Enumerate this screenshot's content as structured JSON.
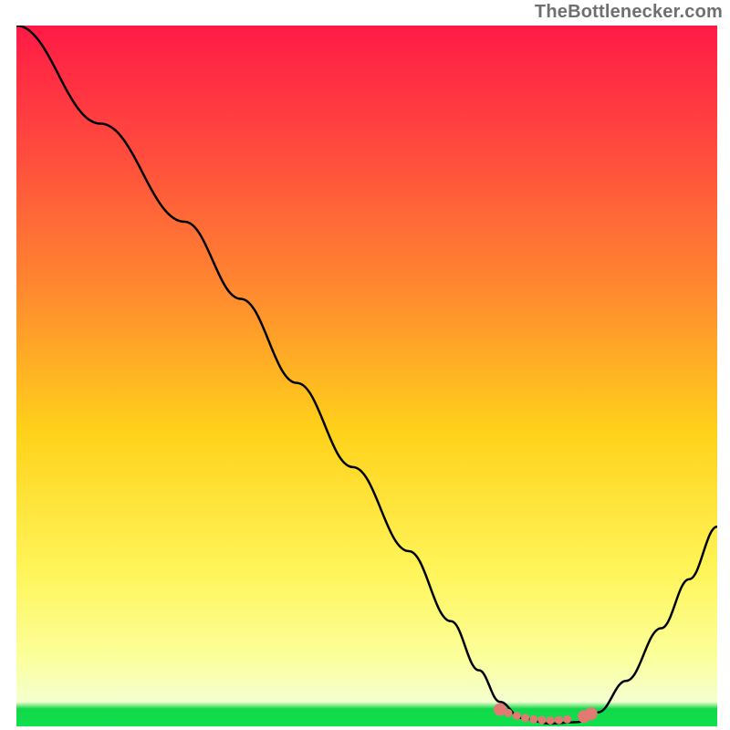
{
  "watermark": "TheBottlenecker.com",
  "chart_data": {
    "type": "line",
    "title": "",
    "xlabel": "",
    "ylabel": "",
    "xlim": [
      0,
      100
    ],
    "ylim": [
      0,
      100
    ],
    "gradient_stops": [
      {
        "offset": 0.0,
        "color": "#ff1a46"
      },
      {
        "offset": 0.18,
        "color": "#ff4b3e"
      },
      {
        "offset": 0.38,
        "color": "#ff8a2f"
      },
      {
        "offset": 0.58,
        "color": "#ffd21a"
      },
      {
        "offset": 0.78,
        "color": "#fff55a"
      },
      {
        "offset": 0.9,
        "color": "#fbff9a"
      },
      {
        "offset": 0.965,
        "color": "#f4ffd0"
      },
      {
        "offset": 0.975,
        "color": "#12d84a"
      },
      {
        "offset": 1.0,
        "color": "#0fe04e"
      }
    ],
    "series": [
      {
        "name": "bottleneck-curve",
        "stroke": "#000000",
        "stroke_width": 2.5,
        "points": [
          {
            "x": 0.0,
            "y": 100.0
          },
          {
            "x": 12.0,
            "y": 86.0
          },
          {
            "x": 24.0,
            "y": 72.0
          },
          {
            "x": 32.0,
            "y": 61.0
          },
          {
            "x": 40.0,
            "y": 49.0
          },
          {
            "x": 48.0,
            "y": 37.0
          },
          {
            "x": 56.0,
            "y": 25.0
          },
          {
            "x": 62.0,
            "y": 15.0
          },
          {
            "x": 66.0,
            "y": 8.0
          },
          {
            "x": 69.0,
            "y": 3.5
          },
          {
            "x": 72.0,
            "y": 1.2
          },
          {
            "x": 76.0,
            "y": 0.4
          },
          {
            "x": 80.0,
            "y": 0.6
          },
          {
            "x": 83.0,
            "y": 2.0
          },
          {
            "x": 87.0,
            "y": 6.5
          },
          {
            "x": 92.0,
            "y": 14.0
          },
          {
            "x": 96.0,
            "y": 21.0
          },
          {
            "x": 100.0,
            "y": 28.5
          }
        ]
      }
    ],
    "markers": {
      "name": "minimum-band",
      "fill": "#e27a73",
      "radius_minor": 4.5,
      "radius_major": 7,
      "points": [
        {
          "x": 69.0,
          "y": 2.4,
          "major": true
        },
        {
          "x": 70.2,
          "y": 1.9,
          "major": false
        },
        {
          "x": 71.4,
          "y": 1.5,
          "major": false
        },
        {
          "x": 72.6,
          "y": 1.2,
          "major": false
        },
        {
          "x": 73.8,
          "y": 1.0,
          "major": false
        },
        {
          "x": 75.0,
          "y": 0.9,
          "major": false
        },
        {
          "x": 76.2,
          "y": 0.85,
          "major": false
        },
        {
          "x": 77.4,
          "y": 0.9,
          "major": false
        },
        {
          "x": 78.6,
          "y": 1.0,
          "major": false
        },
        {
          "x": 81.0,
          "y": 1.4,
          "major": true
        },
        {
          "x": 82.0,
          "y": 1.8,
          "major": true
        }
      ]
    }
  }
}
